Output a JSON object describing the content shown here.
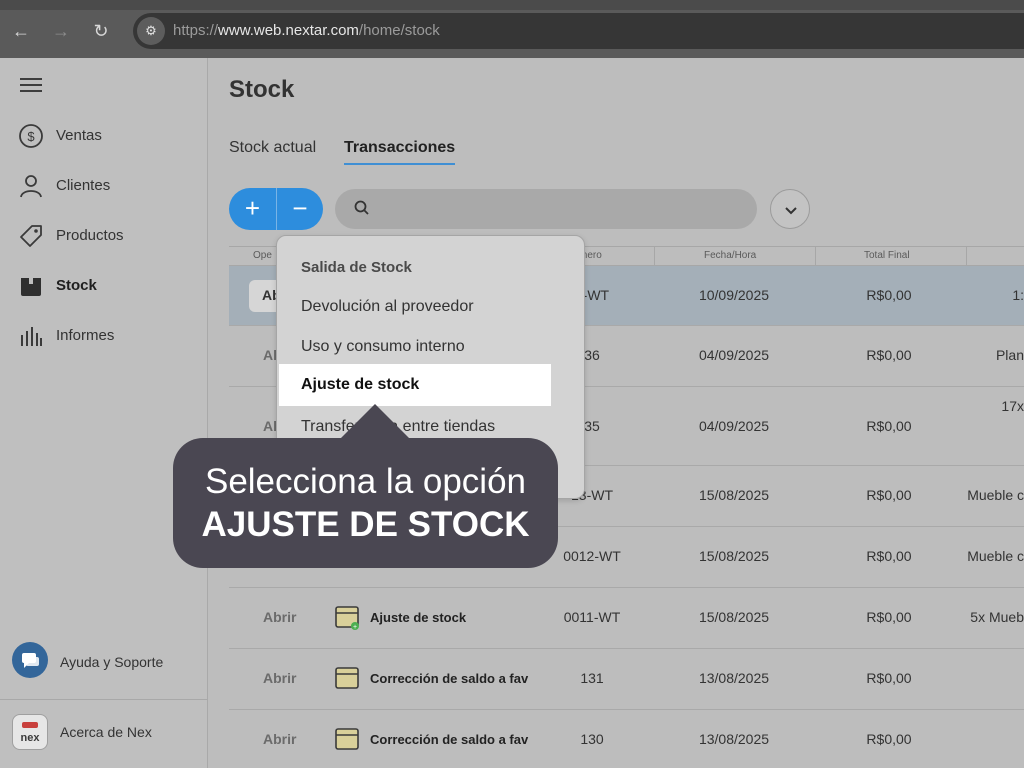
{
  "browser": {
    "url_scheme": "https://",
    "url_host": "www.web.nextar.com",
    "url_path": "/home/stock"
  },
  "sidebar": {
    "items": [
      {
        "label": "Ventas",
        "icon": "dollar-circle-icon"
      },
      {
        "label": "Clientes",
        "icon": "user-icon"
      },
      {
        "label": "Productos",
        "icon": "tag-icon"
      },
      {
        "label": "Stock",
        "icon": "box-icon",
        "active": true
      },
      {
        "label": "Informes",
        "icon": "bar-chart-icon"
      }
    ],
    "help_label": "Ayuda y Soporte",
    "about_label": "Acerca de Nex",
    "logo_text": "nex"
  },
  "main": {
    "title": "Stock",
    "tabs": [
      {
        "label": "Stock actual"
      },
      {
        "label": "Transacciones",
        "active": true
      }
    ],
    "add_label": "+",
    "remove_label": "−"
  },
  "table": {
    "headers": {
      "op": "Ope",
      "num": "mero",
      "date": "Fecha/Hora",
      "total": "Total Final"
    },
    "rows": [
      {
        "action": "Ab",
        "type": "",
        "num": "4-WT",
        "date": "10/09/2025",
        "total": "R$0,00",
        "extra": "1:",
        "selected": true
      },
      {
        "action": "Al",
        "type": "",
        "num": "36",
        "date": "04/09/2025",
        "total": "R$0,00",
        "extra": "Plan"
      },
      {
        "action": "Al",
        "type": "",
        "num": "35",
        "date": "04/09/2025",
        "total": "R$0,00",
        "extra": "17x"
      },
      {
        "action": "",
        "type": "",
        "num": "13-WT",
        "date": "15/08/2025",
        "total": "R$0,00",
        "extra": "Mueble c"
      },
      {
        "action": "",
        "type": "",
        "num": "0012-WT",
        "date": "15/08/2025",
        "total": "R$0,00",
        "extra": "Mueble c"
      },
      {
        "action": "Abrir",
        "type": "Ajuste de stock",
        "num": "0011-WT",
        "date": "15/08/2025",
        "total": "R$0,00",
        "extra": "5x Mueb"
      },
      {
        "action": "Abrir",
        "type": "Corrección de saldo a fav",
        "num": "131",
        "date": "13/08/2025",
        "total": "R$0,00",
        "extra": ""
      },
      {
        "action": "Abrir",
        "type": "Corrección de saldo a fav",
        "num": "130",
        "date": "13/08/2025",
        "total": "R$0,00",
        "extra": ""
      }
    ]
  },
  "menu": {
    "title": "Salida de Stock",
    "items": [
      {
        "label": "Devolución al proveedor"
      },
      {
        "label": "Uso y consumo interno"
      },
      {
        "label": "Ajuste de stock",
        "highlighted": true
      },
      {
        "label": "Transferencia entre tiendas"
      }
    ]
  },
  "callout": {
    "line1": "Selecciona la opción",
    "line2": "AJUSTE DE STOCK"
  },
  "colors": {
    "accent": "#2d8ddd",
    "callout_bg": "#4a4752",
    "selected_row": "#a4afb8"
  }
}
